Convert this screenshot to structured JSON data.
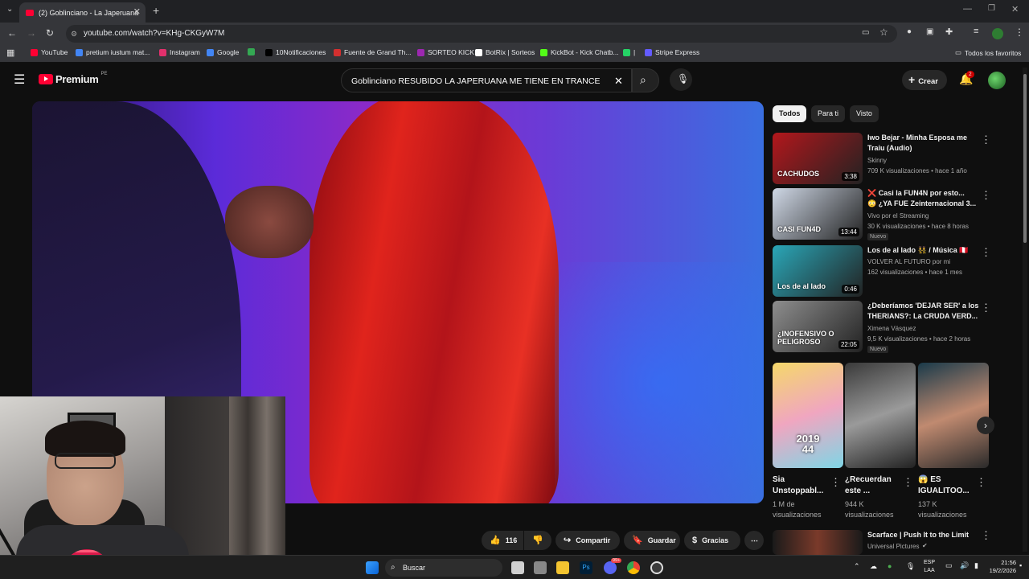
{
  "browser": {
    "tab_title": "(2) Goblinciano - La Japeruana",
    "url": "youtube.com/watch?v=KHg-CKGyW7M",
    "bookmarks": [
      {
        "label": "YouTube",
        "color": "#ff0033"
      },
      {
        "label": "pretium iustum mat...",
        "color": "#4285f4"
      },
      {
        "label": "Instagram",
        "color": "#e1306c"
      },
      {
        "label": "Google",
        "color": "#4285f4"
      },
      {
        "label": "",
        "color": "#34a853"
      },
      {
        "label": "10Notificaciones",
        "color": "#000000"
      },
      {
        "label": "Fuente de Grand Th...",
        "color": "#d32f2f"
      },
      {
        "label": "SORTEO KICK",
        "color": "#9c27b0"
      },
      {
        "label": "BotRix | Sorteos",
        "color": "#ffffff"
      },
      {
        "label": "KickBot - Kick Chatb...",
        "color": "#53fc18"
      },
      {
        "label": "|",
        "color": "#25d366"
      },
      {
        "label": "Stripe Express",
        "color": "#635bff"
      }
    ],
    "all_favorites": "Todos los favoritos"
  },
  "youtube": {
    "logo": "Premium",
    "region": "PE",
    "search_query": "Goblinciano RESUBIDO LA JAPERUANA ME TIENE EN TRANCE",
    "create_label": "Crear",
    "notif_count": "2"
  },
  "chips": [
    "Todos",
    "Para ti",
    "Visto"
  ],
  "recommendations": [
    {
      "title_l1": "Iwo Bejar - Minha Esposa me",
      "title_l2": "Traiu (Audio)",
      "channel": "Skinny",
      "meta": "709 K visualizaciones • hace 1 año",
      "duration": "3:38",
      "badge": "",
      "thumb_text": "CACHUDOS",
      "thumb_color": "#b3171c"
    },
    {
      "title_l1": "❌ Casi la FUN4N por esto...",
      "title_l2": "😳 ¿YA FUE Zeinternacional 3...",
      "channel": "Vivo por el Streaming",
      "meta": "30 K visualizaciones • hace 8 horas",
      "duration": "13:44",
      "badge": "Nuevo",
      "thumb_text": "CASI FUN4D",
      "thumb_color": "#cfd8e6"
    },
    {
      "title_l1": "Los de al lado 👯 / Música 🇵🇪",
      "title_l2": "",
      "channel": "VOLVER AL FUTURO por mi",
      "meta": "162 visualizaciones • hace 1 mes",
      "duration": "0:46",
      "badge": "",
      "thumb_text": "Los de al lado",
      "thumb_color": "#2aa7b8"
    },
    {
      "title_l1": "¿Deberíamos 'DEJAR SER' a los",
      "title_l2": "THERIANS?: La CRUDA VERD...",
      "channel": "Ximena Vásquez",
      "meta": "9,5 K visualizaciones • hace 2 horas",
      "duration": "22:05",
      "badge": "Nuevo",
      "thumb_text": "¿INOFENSIVO O PELIGROSO",
      "thumb_color": "#8e8e8e"
    }
  ],
  "shorts": [
    {
      "title_l1": "Sia",
      "title_l2": "Unstoppabl...",
      "views_l1": "1 M de",
      "views_l2": "visualizaciones",
      "overlay": "2019",
      "overlay2": "44"
    },
    {
      "title_l1": "¿Recuerdan",
      "title_l2": "este ...",
      "views_l1": "944 K",
      "views_l2": "visualizaciones",
      "overlay": "",
      "overlay2": ""
    },
    {
      "title_l1": "😱 ES",
      "title_l2": "IGUALITOO...",
      "views_l1": "137 K",
      "views_l2": "visualizaciones",
      "overlay": "",
      "overlay2": ""
    }
  ],
  "last_rec": {
    "title": "Scarface | Push It to the Limit",
    "channel": "Universal Pictures"
  },
  "actions": {
    "likes": "116",
    "share": "Compartir",
    "save": "Guardar",
    "thanks": "Gracias"
  },
  "taskbar": {
    "search": "Buscar",
    "lang1": "ESP",
    "lang2": "LAA",
    "time": "21:56",
    "date": "19/2/2026",
    "discord_badge": "99+"
  }
}
